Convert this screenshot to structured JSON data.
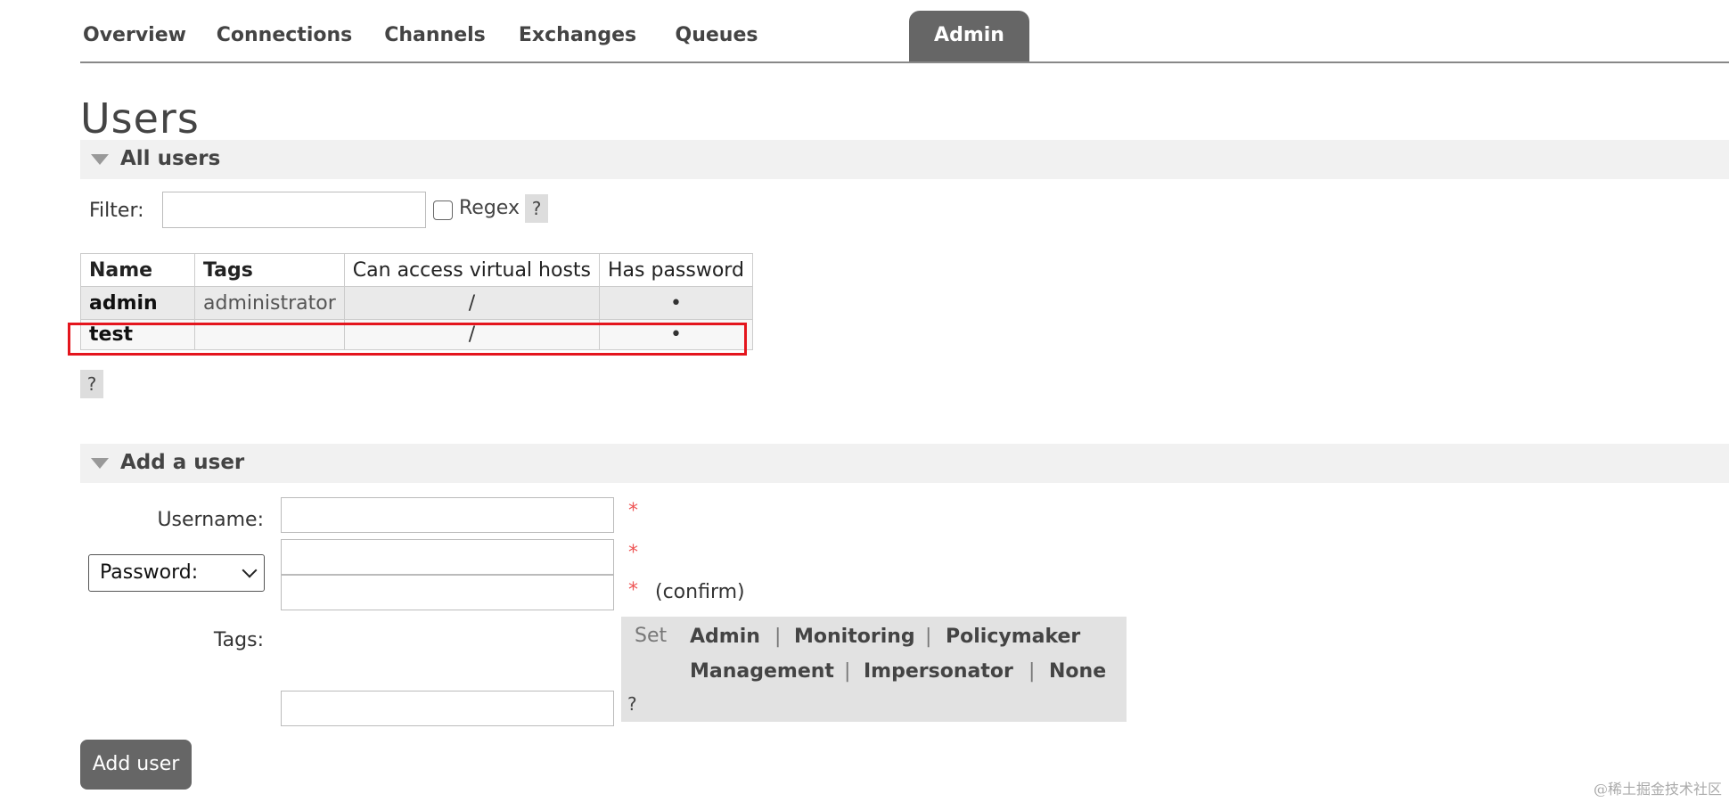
{
  "nav": {
    "tabs": [
      {
        "label": "Overview"
      },
      {
        "label": "Connections"
      },
      {
        "label": "Channels"
      },
      {
        "label": "Exchanges"
      },
      {
        "label": "Queues"
      },
      {
        "label": "Admin",
        "active": true
      }
    ]
  },
  "page_title": "Users",
  "all_users": {
    "section_label": "All users",
    "filter_label": "Filter:",
    "filter_value": "",
    "regex_label": "Regex",
    "regex_checked": false,
    "help_label": "?",
    "table": {
      "columns": [
        "Name",
        "Tags",
        "Can access virtual hosts",
        "Has password"
      ],
      "rows": [
        {
          "name": "admin",
          "tags": "administrator",
          "vhosts": "/",
          "has_password": "•"
        },
        {
          "name": "test",
          "tags": "",
          "vhosts": "/",
          "has_password": "•"
        }
      ]
    },
    "table_help_label": "?"
  },
  "add_user": {
    "section_label": "Add a user",
    "username_label": "Username:",
    "username_value": "",
    "password_select": "Password:",
    "password_value": "",
    "confirm_value": "",
    "confirm_label": "(confirm)",
    "required_mark": "*",
    "tags_label": "Tags:",
    "tags_value": "",
    "tag_set_label": "Set",
    "tag_options": [
      "Admin",
      "Monitoring",
      "Policymaker",
      "Management",
      "Impersonator",
      "None"
    ],
    "tag_separator": "|",
    "tag_help_label": "?",
    "submit_label": "Add user"
  },
  "watermark": "@稀土掘金技术社区",
  "colors": {
    "active_tab": "#666666",
    "section_bar": "#f1f1f1",
    "required": "#ee5555",
    "highlight_border": "#e4151d"
  }
}
